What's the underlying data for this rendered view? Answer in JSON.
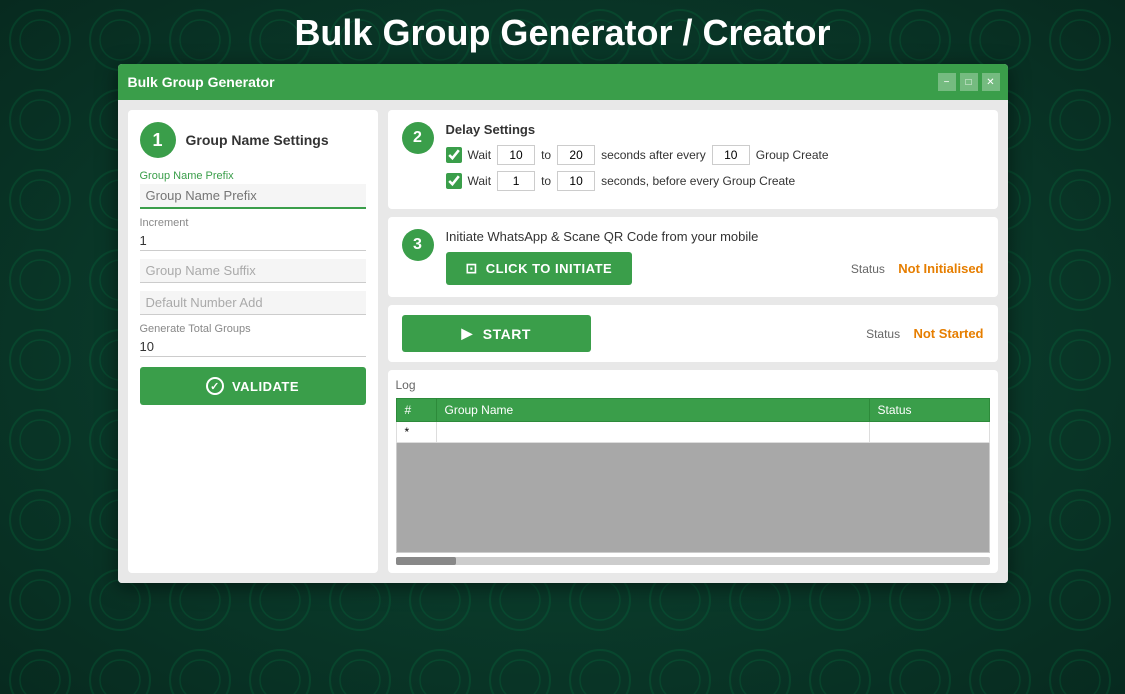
{
  "page": {
    "title": "Bulk Group Generator / Creator"
  },
  "window": {
    "title": "Bulk Group Generator",
    "controls": {
      "minimize": "−",
      "maximize": "□",
      "close": "✕"
    }
  },
  "step1": {
    "number": "1",
    "title": "Group Name Settings",
    "prefix_label": "Group Name Prefix",
    "prefix_value": "",
    "increment_label": "Increment",
    "increment_value": "1",
    "suffix_placeholder": "Group Name Suffix",
    "default_number_placeholder": "Default Number Add",
    "total_label": "Generate Total Groups",
    "total_value": "10",
    "validate_label": "VALIDATE"
  },
  "step2": {
    "number": "2",
    "heading": "Delay Settings",
    "row1": {
      "checked": true,
      "wait_label": "Wait",
      "from": "10",
      "to_label": "to",
      "to": "20",
      "suffix": "seconds after every",
      "every": "10",
      "end": "Group Create"
    },
    "row2": {
      "checked": true,
      "wait_label": "Wait",
      "from": "1",
      "to_label": "to",
      "to": "10",
      "suffix": "seconds, before every Group Create"
    }
  },
  "step3": {
    "number": "3",
    "description": "Initiate WhatsApp & Scane QR Code from your mobile",
    "initiate_label": "CLICK TO INITIATE",
    "status_label": "Status",
    "status_value": "Not Initialised"
  },
  "start": {
    "label": "START",
    "status_label": "Status",
    "status_value": "Not Started"
  },
  "log": {
    "label": "Log",
    "columns": {
      "hash": "#",
      "group_name": "Group Name",
      "status": "Status"
    },
    "rows": [
      {
        "id": "*",
        "group_name": "",
        "status": ""
      }
    ]
  },
  "icons": {
    "check": "✓",
    "play": "▶",
    "initiate": "⊡",
    "validate_check": "✓"
  }
}
